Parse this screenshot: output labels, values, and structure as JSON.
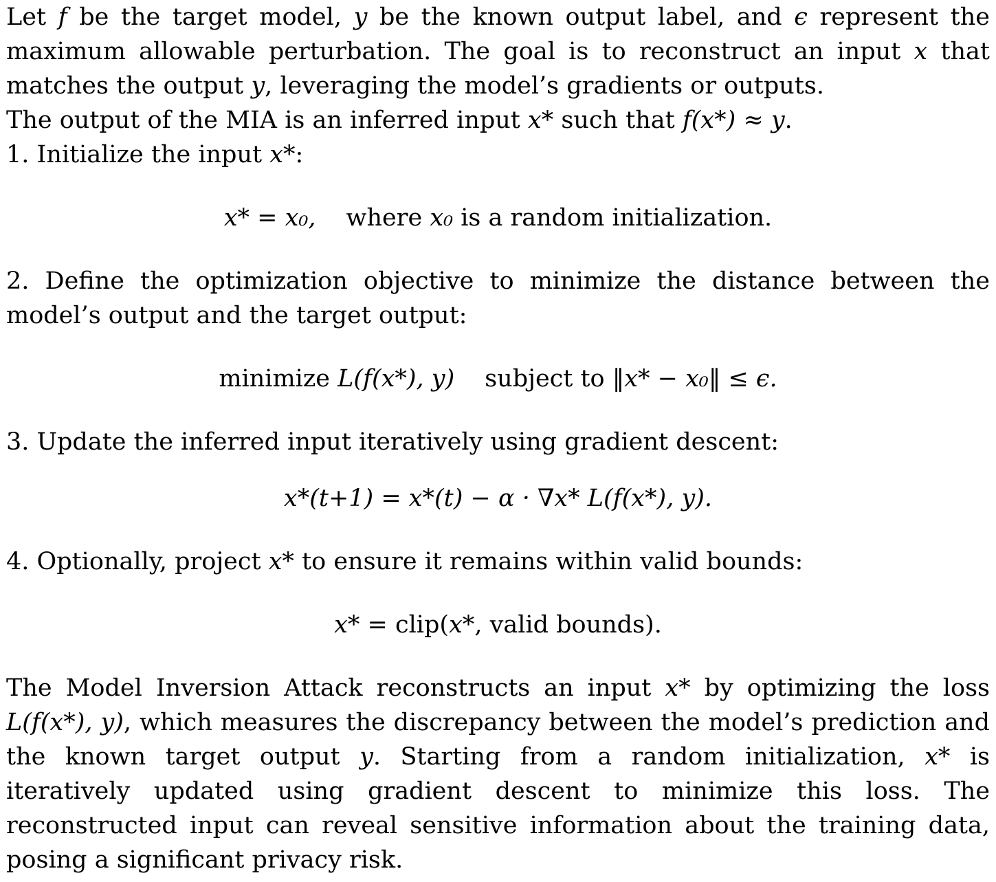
{
  "intro": {
    "line1_a": "Let ",
    "f": "f",
    "line1_b": " be the target model, ",
    "y": "y",
    "line1_c": " be the known output label, and ",
    "eps": "ϵ",
    "line1_d": " represent the maximum allowable perturbation. The goal is to reconstruct an input ",
    "x": "x",
    "line1_e": " that matches the output ",
    "line1_f": ", leveraging the model’s gradients or outputs."
  },
  "output_sentence": {
    "text_a": "The output of the MIA is an inferred input ",
    "xstar": "x*",
    "text_b": " such that ",
    "expr": "f(x*) ≈ y",
    "text_c": "."
  },
  "step1": {
    "label": "1. Initialize the input ",
    "var": "x*",
    "suffix": ":",
    "eq_lhs": "x* = x₀,",
    "eq_text_a": "where ",
    "eq_var": "x₀",
    "eq_text_b": " is a random initialization."
  },
  "step2": {
    "text": "2.  Define the optimization objective to minimize the distance between the model’s output and the target output:",
    "eq_a": "minimize ",
    "eq_b": "L(f(x*), y)",
    "eq_c": "subject to ",
    "eq_d": "‖x* − x₀‖ ≤ ϵ."
  },
  "step3": {
    "text": "3. Update the inferred input iteratively using gradient descent:",
    "eq": "x*(t+1) = x*(t) − α · ∇x* L(f(x*), y)."
  },
  "step4": {
    "text_a": "4. Optionally, project ",
    "var": "x*",
    "text_b": " to ensure it remains within valid bounds:",
    "eq_a": "x* = ",
    "eq_b": "clip(",
    "eq_c": "x*",
    "eq_d": ", valid bounds)."
  },
  "summary": {
    "text_a": "The Model Inversion Attack reconstructs an input ",
    "xstar": "x*",
    "text_b": " by optimizing the loss ",
    "loss": "L(f(x*), y)",
    "text_c": ", which measures the discrepancy between the model’s prediction and the known target output ",
    "y": "y",
    "text_d": ". Starting from a random initialization, ",
    "text_e": " is iteratively updated using gradient descent to minimize this loss. The reconstructed input can reveal sensitive information about the training data, posing a significant privacy risk."
  }
}
